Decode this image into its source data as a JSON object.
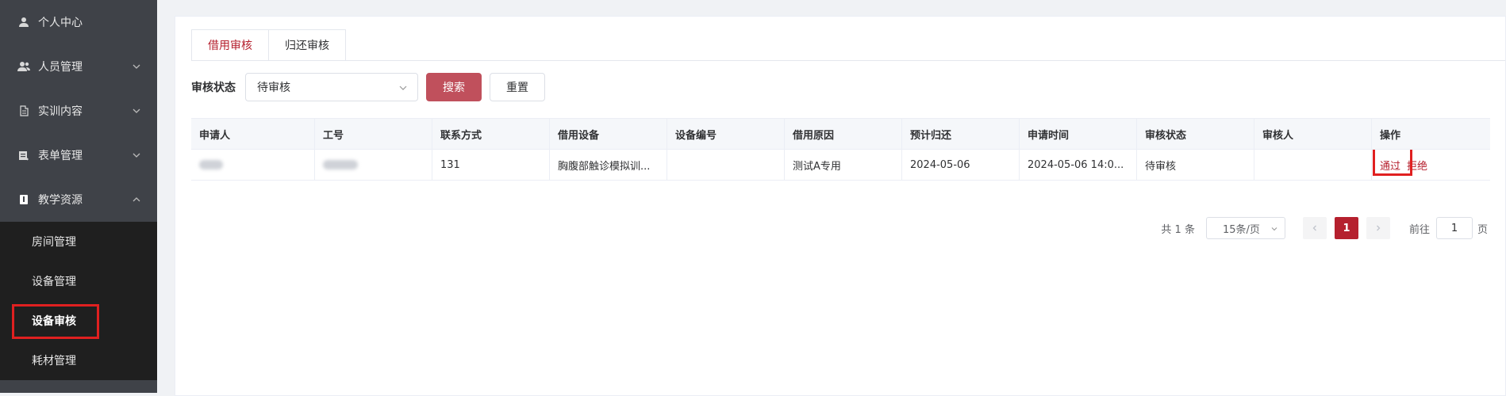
{
  "sidebar": {
    "items": [
      {
        "label": "个人中心",
        "icon": "user-icon",
        "has_children": false
      },
      {
        "label": "人员管理",
        "icon": "users-icon",
        "has_children": true
      },
      {
        "label": "实训内容",
        "icon": "book-icon",
        "has_children": true
      },
      {
        "label": "表单管理",
        "icon": "form-icon",
        "has_children": true
      },
      {
        "label": "教学资源",
        "icon": "resource-icon",
        "has_children": true,
        "expanded": true
      }
    ],
    "submenu": [
      {
        "label": "房间管理"
      },
      {
        "label": "设备管理"
      },
      {
        "label": "设备审核",
        "active": true
      },
      {
        "label": "耗材管理"
      }
    ]
  },
  "tabs": [
    {
      "label": "借用审核",
      "active": true
    },
    {
      "label": "归还审核",
      "active": false
    }
  ],
  "filter": {
    "status_label": "审核状态",
    "status_value": "待审核",
    "search_label": "搜索",
    "reset_label": "重置"
  },
  "table": {
    "headers": [
      "申请人",
      "工号",
      "联系方式",
      "借用设备",
      "设备编号",
      "借用原因",
      "预计归还",
      "申请时间",
      "审核状态",
      "审核人",
      "操作"
    ],
    "rows": [
      {
        "applicant": "",
        "employee_id": "",
        "contact": "131",
        "device": "胸腹部触诊模拟训...",
        "device_no": "",
        "reason": "测试A专用",
        "expected_return": "2024-05-06",
        "apply_time": "2024-05-06 14:0...",
        "status": "待审核",
        "reviewer": "",
        "approve_label": "通过",
        "reject_label": "拒绝"
      }
    ]
  },
  "pagination": {
    "total_text": "共 1 条",
    "page_size": "15条/页",
    "current_page": "1",
    "goto_label": "前往",
    "goto_value": "1",
    "page_unit": "页"
  },
  "colors": {
    "accent": "#b5202e",
    "primary_button": "#c0505c",
    "sidebar_bg": "#3f4248",
    "submenu_bg": "#1f1f1f",
    "highlight_border": "#e02020"
  }
}
